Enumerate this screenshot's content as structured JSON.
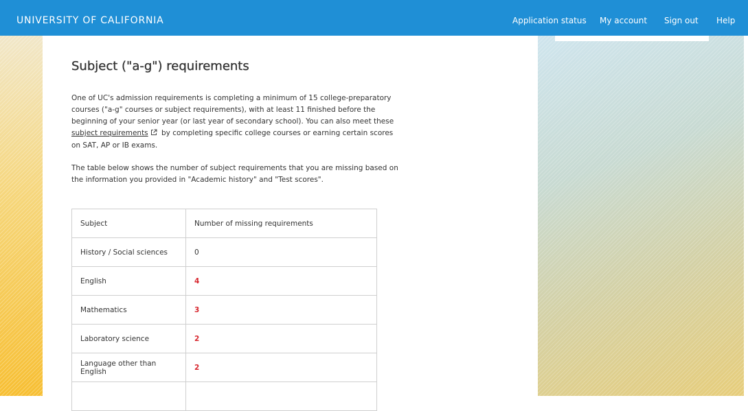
{
  "header": {
    "brand": "UNIVERSITY OF CALIFORNIA",
    "nav": [
      "Application status",
      "My account",
      "Sign out",
      "Help"
    ],
    "background_color": "#1f8fd6"
  },
  "page": {
    "title": "Subject (\"a-g\") requirements",
    "intro_before_link": "One of UC's admission requirements is completing a minimum of 15 college-preparatory courses (\"a-g\" courses or subject requirements), with at least 11 finished before the beginning of your senior year (or last year of secondary school). You can also meet these ",
    "intro_link": "subject requirements",
    "intro_after_link": " by completing specific college courses or earning certain scores on SAT, AP or IB exams.",
    "table_intro": "The table below shows the number of subject requirements that you are missing based on the information you provided in \"Academic history\" and \"Test scores\"."
  },
  "table": {
    "headers": [
      "Subject",
      "Number of missing requirements"
    ],
    "rows": [
      {
        "subject": "History / Social sciences",
        "missing": "0"
      },
      {
        "subject": "English",
        "missing": "4"
      },
      {
        "subject": "Mathematics",
        "missing": "3"
      },
      {
        "subject": "Laboratory science",
        "missing": "2"
      },
      {
        "subject": "Language other than English",
        "missing": "2"
      }
    ],
    "missing_color": "#d7272f"
  },
  "icons": {
    "external_link": "external-link-icon"
  }
}
